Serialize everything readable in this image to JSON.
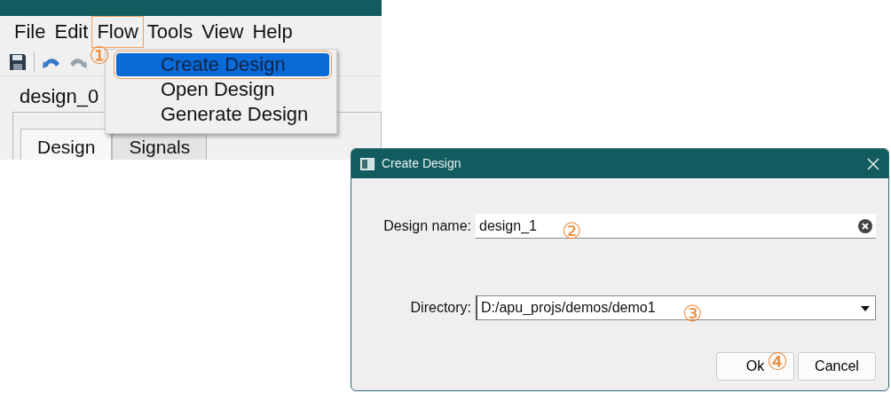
{
  "app_window": {
    "menu": [
      {
        "label": "File",
        "selected": false
      },
      {
        "label": "Edit",
        "selected": false
      },
      {
        "label": "Flow",
        "selected": true
      },
      {
        "label": "Tools",
        "selected": false
      },
      {
        "label": "View",
        "selected": false
      },
      {
        "label": "Help",
        "selected": false
      }
    ],
    "document_tab": "design_0",
    "tabs": [
      {
        "label": "Design",
        "selected": true
      },
      {
        "label": "Signals",
        "selected": false
      }
    ],
    "flow_menu": [
      {
        "label": "Create Design",
        "selected": true
      },
      {
        "label": "Open Design",
        "selected": false
      },
      {
        "label": "Generate Design",
        "selected": false
      }
    ]
  },
  "dialog": {
    "title": "Create Design",
    "fields": [
      {
        "kind": "text",
        "label": "Design name:",
        "value": "design_1"
      },
      {
        "kind": "combo",
        "label": "Directory:",
        "value": "D:/apu_projs/demos/demo1"
      }
    ],
    "buttons": [
      "Ok",
      "Cancel"
    ]
  },
  "annotations": [
    "①",
    "②",
    "③",
    "④"
  ]
}
